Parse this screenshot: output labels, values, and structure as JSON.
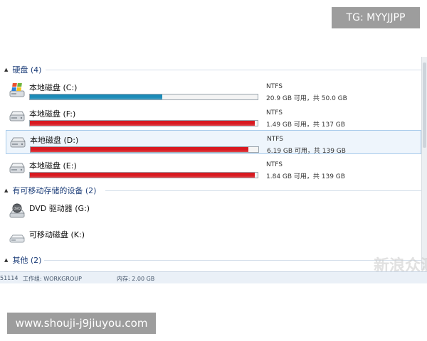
{
  "explorer": {
    "groups": [
      {
        "label": "硬盘 (4)"
      },
      {
        "label": "有可移动存储的设备 (2)"
      },
      {
        "label": "其他 (2)"
      }
    ],
    "drives": [
      {
        "name": "本地磁盘 (C:)",
        "fs": "NTFS",
        "capacity": "20.9 GB 可用，共 50.0 GB",
        "used_fraction": 0.58,
        "bar_color": "#1b8bb8",
        "icon": "windows-drive-icon"
      },
      {
        "name": "本地磁盘 (F:)",
        "fs": "NTFS",
        "capacity": "1.49 GB 可用，共 137 GB",
        "used_fraction": 0.989,
        "bar_color": "#d81920",
        "icon": "hard-drive-icon"
      },
      {
        "name": "本地磁盘 (D:)",
        "fs": "NTFS",
        "capacity": "6.19 GB 可用，共 139 GB",
        "used_fraction": 0.955,
        "bar_color": "#d81920",
        "icon": "hard-drive-icon"
      },
      {
        "name": "本地磁盘 (E:)",
        "fs": "NTFS",
        "capacity": "1.84 GB 可用，共 139 GB",
        "used_fraction": 0.987,
        "bar_color": "#d81920",
        "icon": "hard-drive-icon"
      }
    ],
    "devices": [
      {
        "name": "DVD 驱动器 (G:)",
        "icon": "dvd-drive-icon"
      },
      {
        "name": "可移动磁盘 (K:)",
        "icon": "removable-disk-icon"
      }
    ]
  },
  "status_bar": {
    "computer": "51114",
    "workgroup": "工作组: WORKGROUP",
    "memory": "内存: 2.00 GB"
  },
  "watermarks": {
    "top": "TG: MYYJJPP",
    "bottom": "www.shouji-j9jiuyou.com",
    "logo": "新浪众测"
  }
}
